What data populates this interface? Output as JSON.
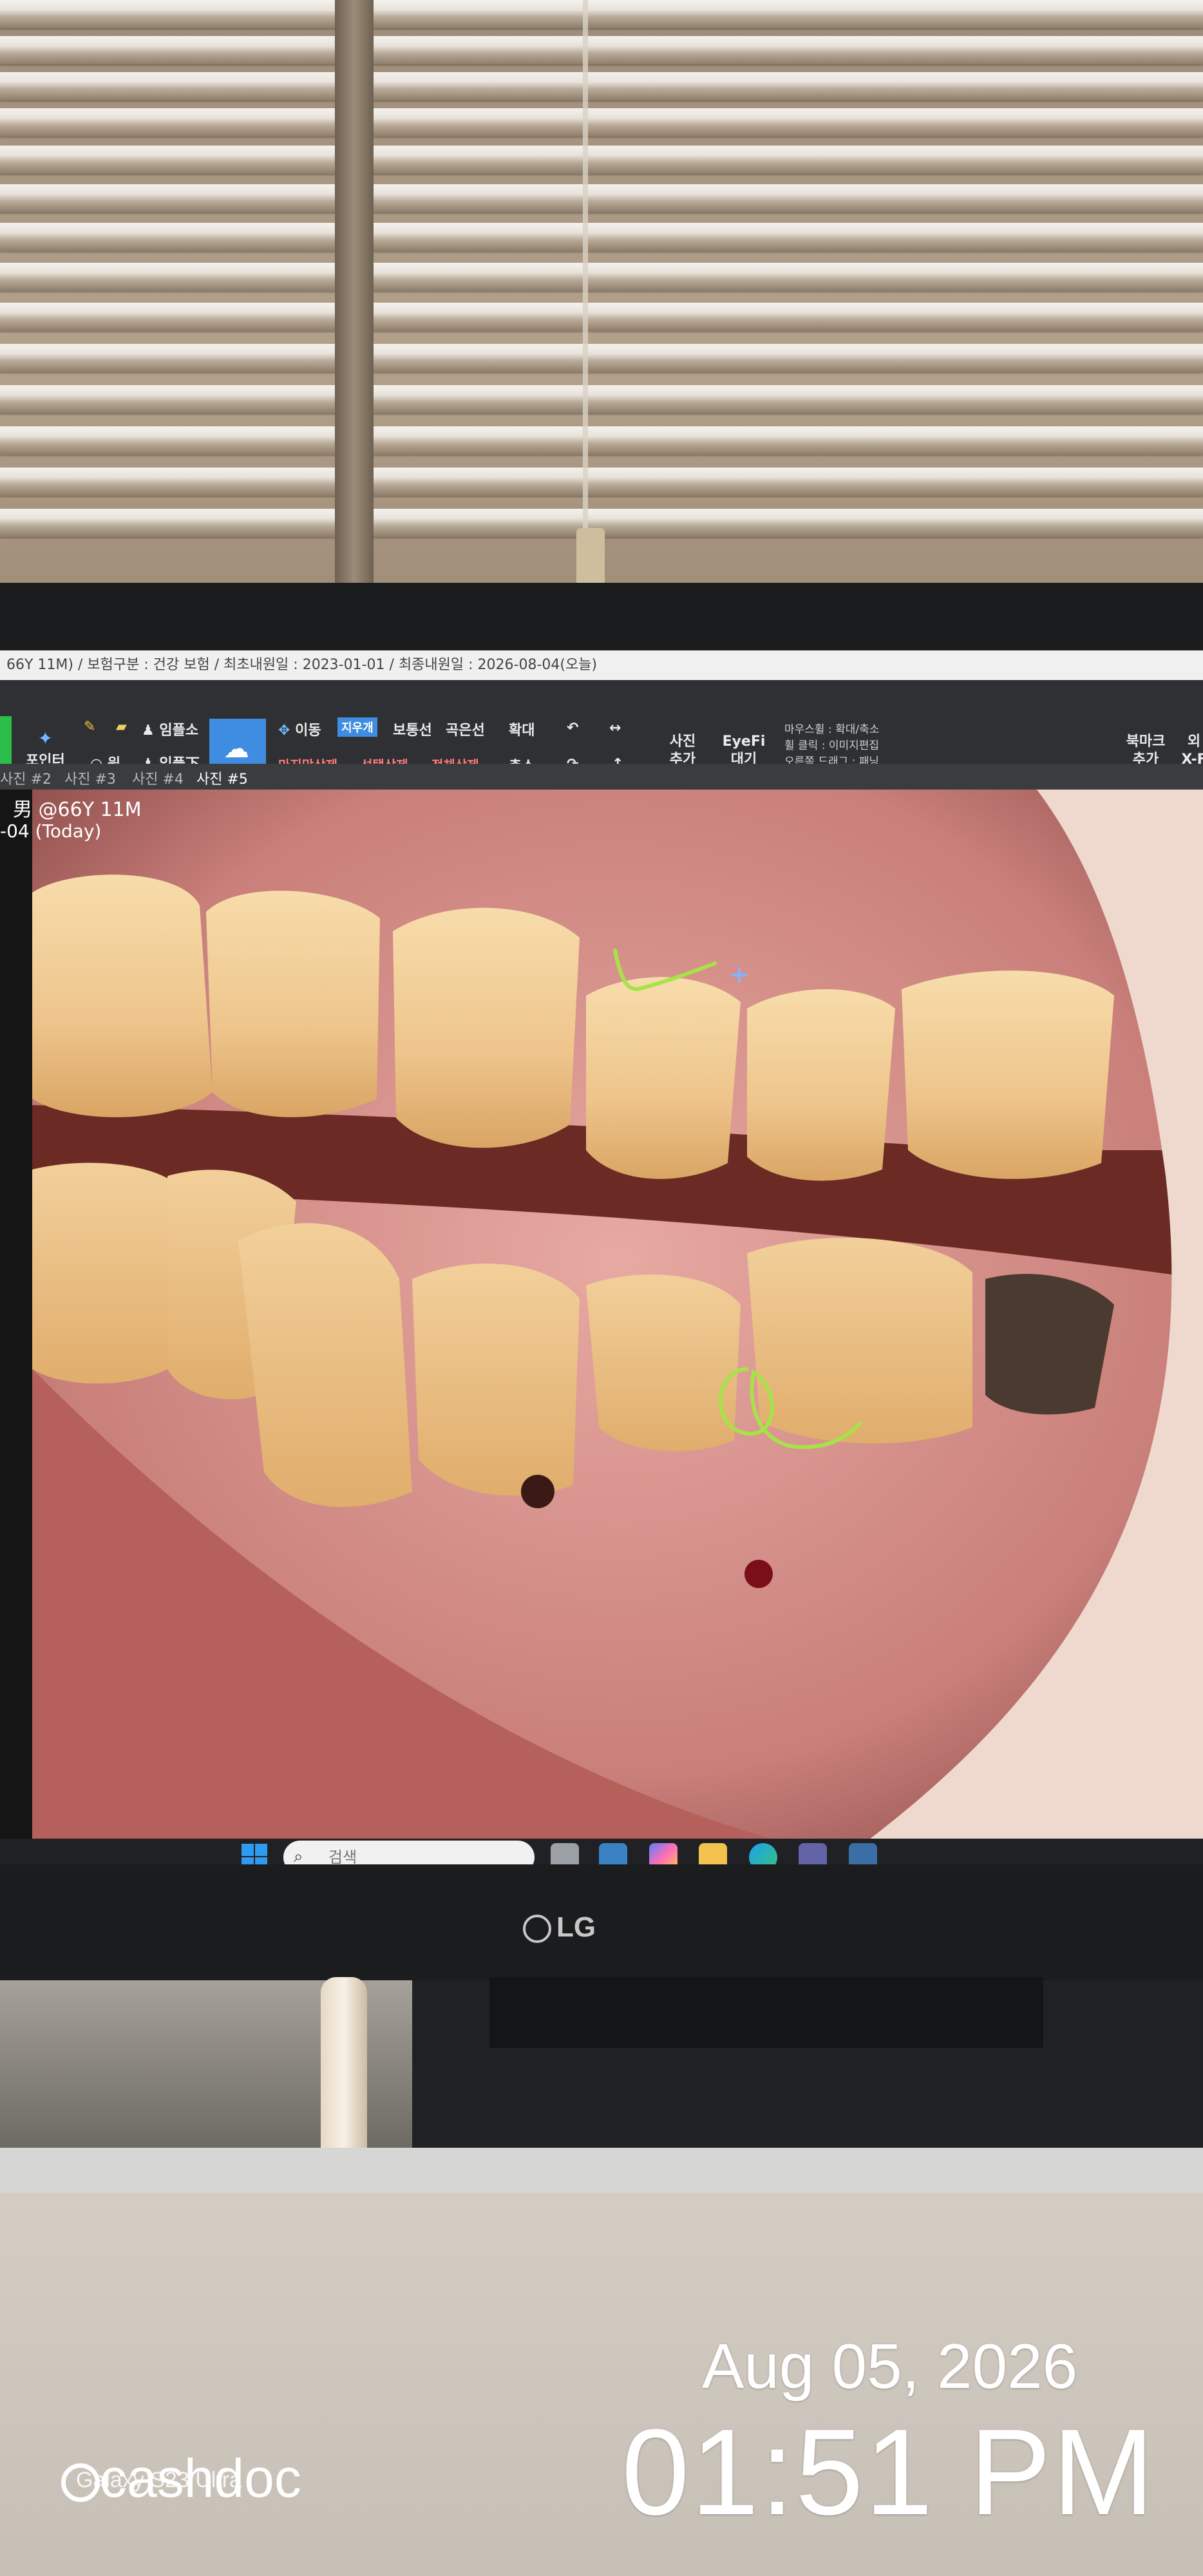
{
  "window_title": "66Y 11M) / 보험구분 : 건강 보험 / 최초내원일 : 2023-01-01 / 최종내원일 : 2026-08-04(오늘)",
  "toolbar": {
    "pointer": "포인터",
    "group1": [
      "임플소",
      "임플下"
    ],
    "select_tool": "지우개",
    "move": "이동",
    "straight_line": "보통선",
    "curve_line": "곡은선",
    "zoom_in": "확대",
    "zoom_out": "축소",
    "undo_last": "마지막삭제",
    "delete_selected": "선택삭제",
    "delete_all": "전체삭제",
    "add_photo": "사진 추가",
    "eyefi_wait": "EyeFi 대기",
    "mouse_hints": [
      "마우스휠 : 확대/축소",
      "휠 클릭 : 이미지편집",
      "오른쪽 드래그 : 패닝"
    ],
    "bookmark_add": "북마크 추가",
    "xray": "외 X-F"
  },
  "tabs": [
    "사진 #2",
    "사진 #3",
    "사진 #4",
    "사진 #5"
  ],
  "patient": {
    "line1": "男 @66Y 11M",
    "line2": "-04 (Today)"
  },
  "taskbar": {
    "search_placeholder": "검색"
  },
  "monitor_brand": "LG",
  "photo_stamp": {
    "date": "Aug 05, 2026",
    "time": "01:51 PM",
    "brand": "cashdoc",
    "device": "Galaxy S23 Ultra"
  },
  "colors": {
    "annotation_green": "#a8e24a",
    "toolbar_bg": "#2e3033",
    "accent_blue": "#3e8de0"
  }
}
